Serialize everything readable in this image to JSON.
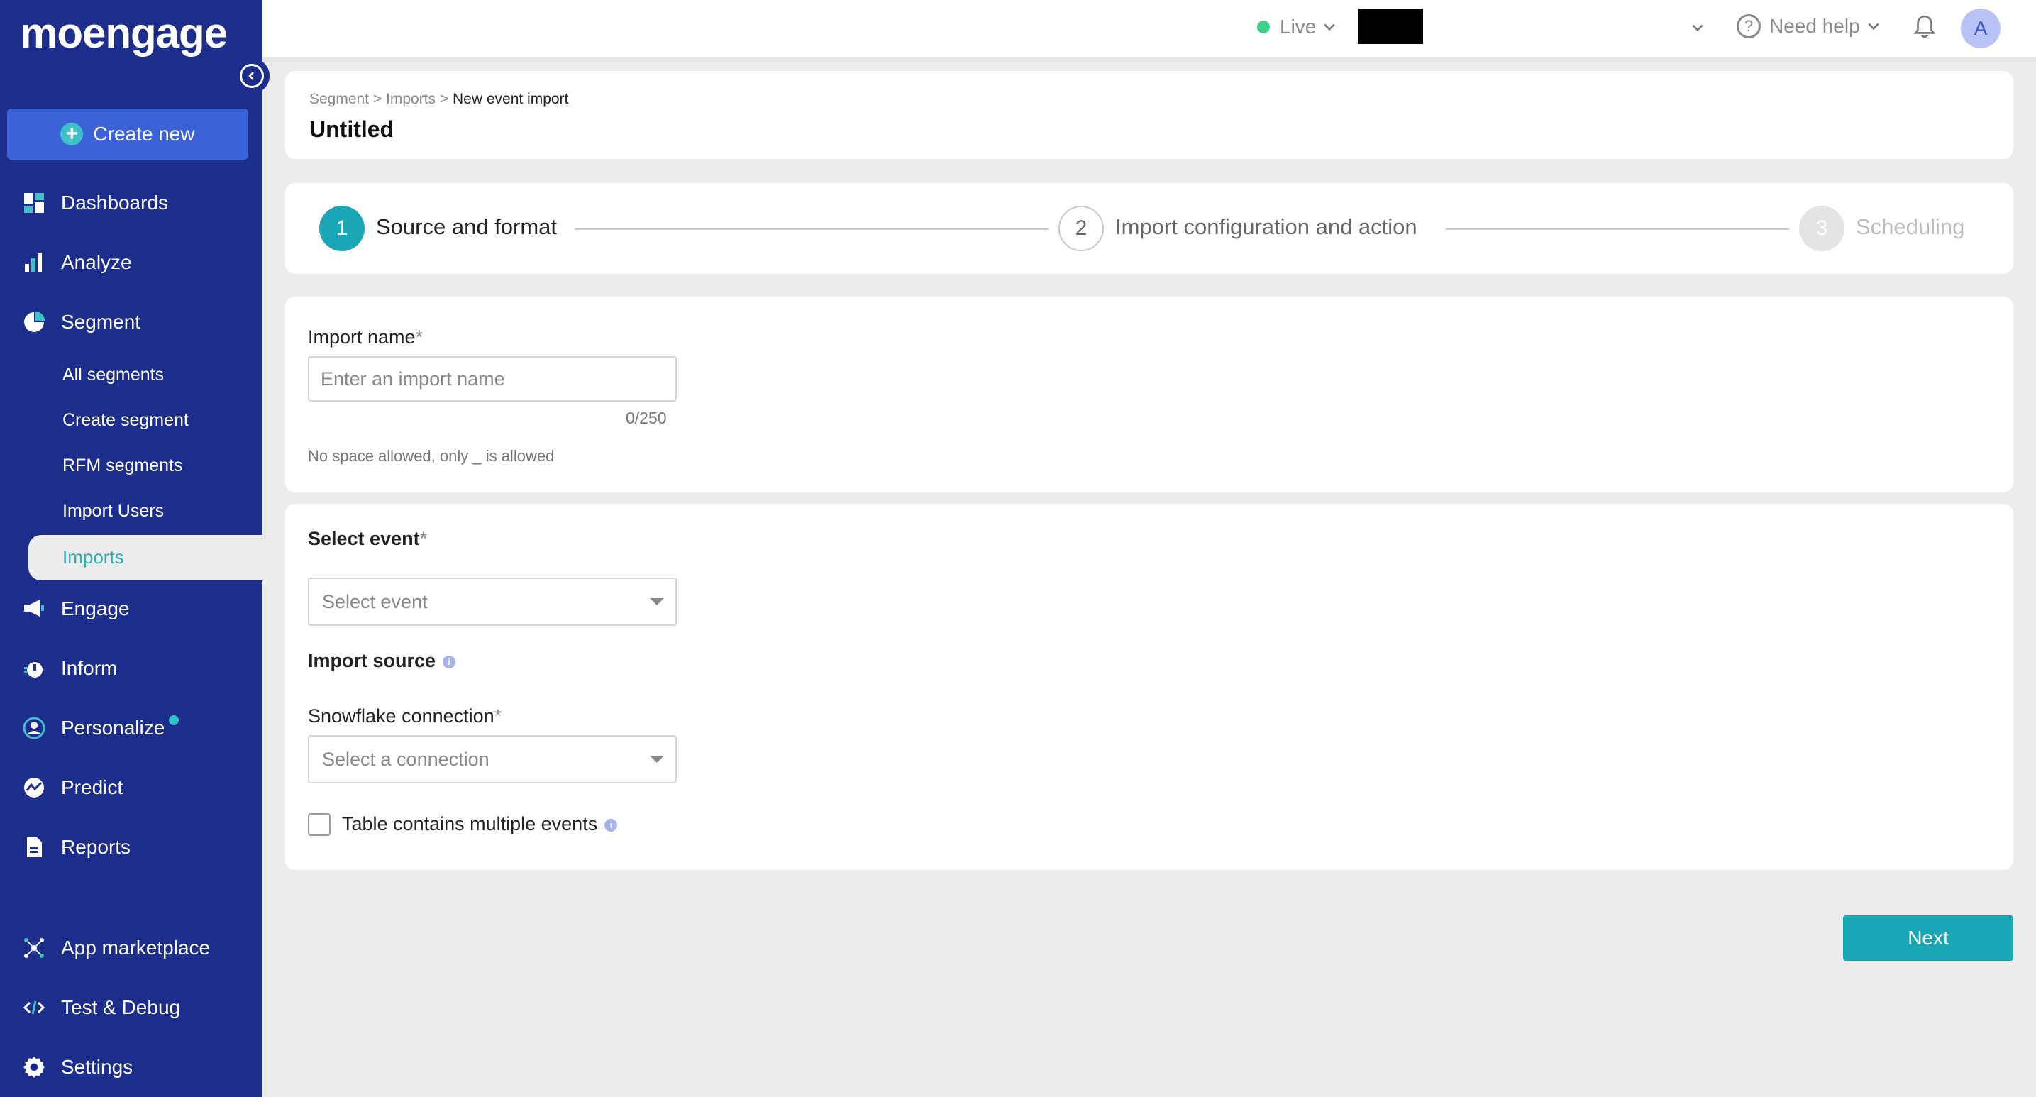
{
  "sidebar": {
    "logo": "moengage",
    "create_new": "Create new",
    "items": [
      {
        "label": "Dashboards",
        "icon": "dashboards-icon"
      },
      {
        "label": "Analyze",
        "icon": "analyze-icon"
      },
      {
        "label": "Segment",
        "icon": "segment-icon"
      },
      {
        "label": "Engage",
        "icon": "engage-icon"
      },
      {
        "label": "Inform",
        "icon": "inform-icon"
      },
      {
        "label": "Personalize",
        "icon": "personalize-icon"
      },
      {
        "label": "Predict",
        "icon": "predict-icon"
      },
      {
        "label": "Reports",
        "icon": "reports-icon"
      },
      {
        "label": "App marketplace",
        "icon": "app-marketplace-icon"
      },
      {
        "label": "Test & Debug",
        "icon": "code-icon"
      },
      {
        "label": "Settings",
        "icon": "settings-gear-icon"
      }
    ],
    "segment_sub": [
      {
        "label": "All segments"
      },
      {
        "label": "Create segment"
      },
      {
        "label": "RFM segments"
      },
      {
        "label": "Import Users"
      },
      {
        "label": "Imports"
      }
    ]
  },
  "topbar": {
    "env": "Live",
    "need_help": "Need help",
    "avatar_initial": "A"
  },
  "header": {
    "breadcrumb": [
      "Segment",
      "Imports",
      "New event import"
    ],
    "title": "Untitled"
  },
  "stepper": [
    {
      "number": "1",
      "label": "Source and format"
    },
    {
      "number": "2",
      "label": "Import configuration and action"
    },
    {
      "number": "3",
      "label": "Scheduling"
    }
  ],
  "import_name": {
    "label": "Import name",
    "placeholder": "Enter an import name",
    "counter": "0/250",
    "helper": "No space allowed, only _ is allowed"
  },
  "event_section": {
    "select_event_label": "Select event",
    "select_event_placeholder": "Select event",
    "import_source_label": "Import source",
    "snowflake_label": "Snowflake connection",
    "snowflake_placeholder": "Select a connection",
    "multiple_events_label": "Table contains multiple events"
  },
  "actions": {
    "next": "Next"
  },
  "colors": {
    "sidebar_bg": "#1c2d8c",
    "accent_teal": "#1aa6b4",
    "create_btn": "#3a63d8"
  }
}
